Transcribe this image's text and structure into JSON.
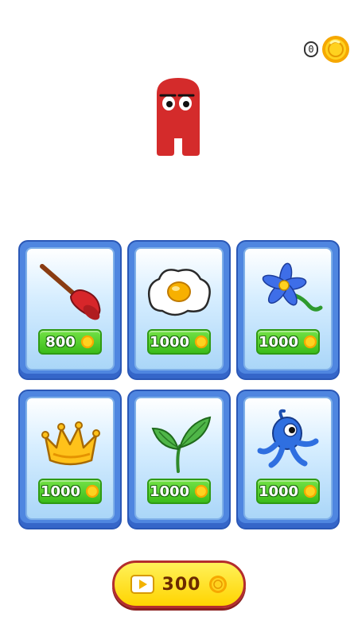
{
  "header": {
    "coin_count": "0"
  },
  "shop": {
    "items": [
      {
        "name": "plunger-icon",
        "price": "800"
      },
      {
        "name": "fried-egg-icon",
        "price": "1000"
      },
      {
        "name": "blue-flower-icon",
        "price": "1000"
      },
      {
        "name": "crown-icon",
        "price": "1000"
      },
      {
        "name": "sprout-icon",
        "price": "1000"
      },
      {
        "name": "blue-octopus-icon",
        "price": "1000"
      }
    ]
  },
  "reward": {
    "watch_price": "300"
  },
  "colors": {
    "card_blue": "#4f86e0",
    "price_green": "#3bbc1a",
    "coin_gold": "#f6b600",
    "character_red": "#d42b2b"
  }
}
